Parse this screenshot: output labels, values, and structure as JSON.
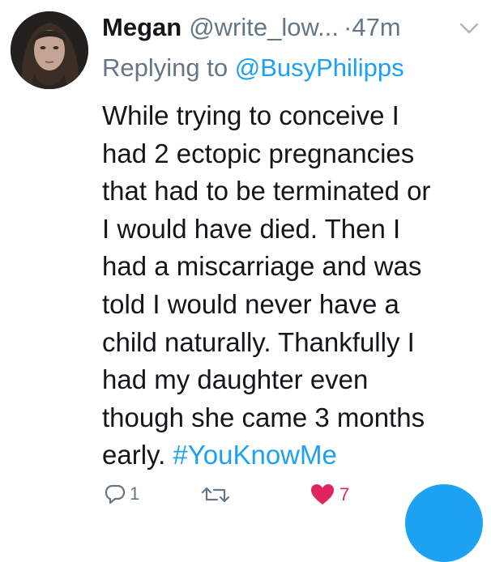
{
  "tweet": {
    "display_name": "Megan",
    "handle": "@write_low...",
    "timestamp": "·47m",
    "replying_prefix": "Replying to ",
    "replying_to": "@BusyPhilipps",
    "body_lines": [
      "While trying to conceive I",
      "had 2 ectopic pregnancies",
      "that had to be terminated or",
      "I would have died. Then I",
      "had a miscarriage and was",
      "told I would never have a",
      "child naturally. Thankfully I",
      "had my daughter even",
      "though she came 3 months",
      "early. "
    ],
    "hashtag": "#YouKnowMe"
  },
  "actions": {
    "reply_icon": "reply-icon",
    "reply_count": "1",
    "retweet_icon": "retweet-icon",
    "like_icon": "heart-icon",
    "like_count": "7"
  },
  "colors": {
    "link": "#1da1f2",
    "muted": "#657786",
    "text": "#14171a",
    "like": "#e0245e"
  }
}
